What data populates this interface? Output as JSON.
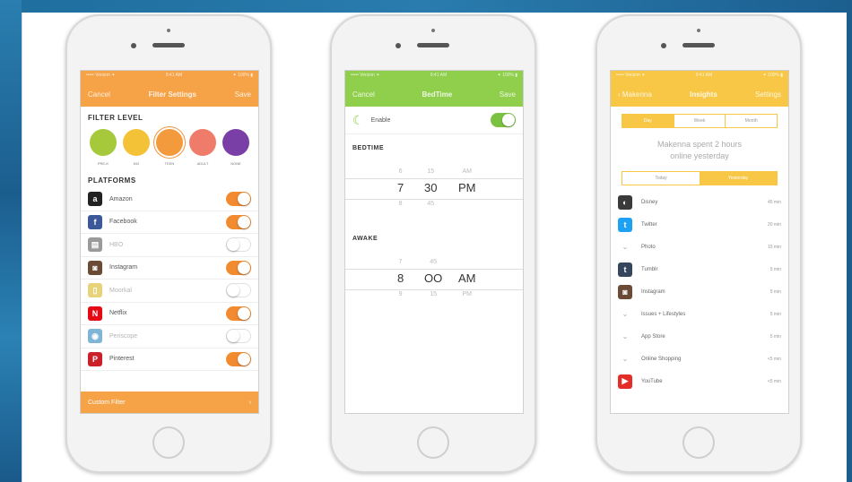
{
  "colors": {
    "orange": "#f6a246",
    "green": "#8fcf4b",
    "yellow": "#f7c745",
    "toggle_on": "#f28a2f"
  },
  "phone1": {
    "status": {
      "left": "••••• Verizon ✦",
      "center": "9:41 AM",
      "right": "✦ 100% ▮"
    },
    "nav": {
      "left": "Cancel",
      "title": "Filter Settings",
      "right": "Save"
    },
    "filter_level_title": "FILTER LEVEL",
    "levels": [
      {
        "label": "PRE-K",
        "color": "#a5c93b",
        "selected": false
      },
      {
        "label": "KID",
        "color": "#f4c237",
        "selected": false
      },
      {
        "label": "TEEN",
        "color": "#f39a3c",
        "selected": true
      },
      {
        "label": "ADULT",
        "color": "#ef7b6a",
        "selected": false
      },
      {
        "label": "NONE",
        "color": "#7a3fa6",
        "selected": false
      }
    ],
    "platforms_title": "PLATFORMS",
    "platforms": [
      {
        "name": "Amazon",
        "icon": "amazon-icon",
        "glyph": "a",
        "color": "#222222",
        "on": true
      },
      {
        "name": "Facebook",
        "icon": "facebook-icon",
        "glyph": "f",
        "color": "#3b5998",
        "on": true
      },
      {
        "name": "HBO",
        "icon": "hbo-icon",
        "glyph": "▤",
        "color": "#9a9a9a",
        "on": false
      },
      {
        "name": "Instagram",
        "icon": "instagram-icon",
        "glyph": "◙",
        "color": "#6b4a36",
        "on": true
      },
      {
        "name": "Moorkal",
        "icon": "moorkal-icon",
        "glyph": "▯",
        "color": "#e8d37a",
        "on": false
      },
      {
        "name": "Netflix",
        "icon": "netflix-icon",
        "glyph": "N",
        "color": "#e50914",
        "on": true
      },
      {
        "name": "Periscope",
        "icon": "periscope-icon",
        "glyph": "◉",
        "color": "#7fb6d8",
        "on": false
      },
      {
        "name": "Pinterest",
        "icon": "pinterest-icon",
        "glyph": "P",
        "color": "#cb2027",
        "on": true
      }
    ],
    "footer": {
      "label": "Custom Filter",
      "chevron": "›"
    }
  },
  "phone2": {
    "status": {
      "left": "••••• Verizon ✦",
      "center": "9:41 AM",
      "right": "✦ 100% ▮"
    },
    "nav": {
      "left": "Cancel",
      "title": "BedTime",
      "right": "Save"
    },
    "enable_label": "Enable",
    "bedtime_title": "BEDTIME",
    "bedtime": {
      "hour_above": "6",
      "min_above": "15",
      "ampm_above": "AM",
      "hour": "7",
      "min": "30",
      "ampm": "PM",
      "hour_below": "8",
      "min_below": "45"
    },
    "awake_title": "AWAKE",
    "awake": {
      "hour_above": "7",
      "min_above": "45",
      "hour": "8",
      "min": "OO",
      "ampm": "AM",
      "hour_below": "9",
      "min_below": "15",
      "ampm_below": "PM"
    }
  },
  "phone3": {
    "status": {
      "left": "••••• Verizon ✦",
      "center": "9:41 AM",
      "right": "✦ 100% ▮"
    },
    "nav": {
      "left": "‹ Makenna",
      "title": "Insights",
      "right": "Settings"
    },
    "range_tabs": [
      "Day",
      "Week",
      "Month"
    ],
    "range_selected": 0,
    "summary_line1": "Makenna spent 2 hours",
    "summary_line2": "online yesterday",
    "day_tabs": [
      "Today",
      "Yesterday"
    ],
    "day_selected": 1,
    "usage": [
      {
        "name": "Disney",
        "time": "45 min",
        "icon": "disney-icon",
        "glyph": "◐",
        "color": "#3a3a3a",
        "chevron": false
      },
      {
        "name": "Twitter",
        "time": "20 min",
        "icon": "twitter-icon",
        "glyph": "t",
        "color": "#1da1f2",
        "chevron": false
      },
      {
        "name": "Photo",
        "time": "15 min",
        "icon": "chevron-down-icon",
        "glyph": "⌄",
        "color": "",
        "chevron": true
      },
      {
        "name": "Tumblr",
        "time": "5 min",
        "icon": "tumblr-icon",
        "glyph": "t",
        "color": "#36465d",
        "chevron": false
      },
      {
        "name": "Instagram",
        "time": "5 min",
        "icon": "instagram-icon",
        "glyph": "◙",
        "color": "#6b4a36",
        "chevron": false
      },
      {
        "name": "Issues + Lifestyles",
        "time": "5 min",
        "icon": "chevron-down-icon",
        "glyph": "⌄",
        "color": "",
        "chevron": true
      },
      {
        "name": "App Store",
        "time": "5 min",
        "icon": "chevron-down-icon",
        "glyph": "⌄",
        "color": "",
        "chevron": true
      },
      {
        "name": "Online Shopping",
        "time": "<5 min",
        "icon": "chevron-down-icon",
        "glyph": "⌄",
        "color": "",
        "chevron": true
      },
      {
        "name": "YouTube",
        "time": "<5 min",
        "icon": "youtube-icon",
        "glyph": "▶",
        "color": "#e52d27",
        "chevron": false
      }
    ]
  }
}
